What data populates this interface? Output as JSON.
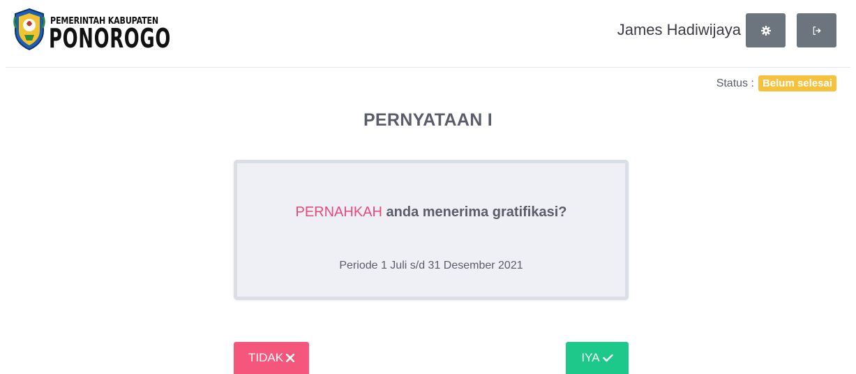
{
  "header": {
    "logo_line1": "PEMERINTAH KABUPATEN",
    "logo_line2": "PONOROGO",
    "username": "James Hadiwijaya",
    "settings_icon": "gear-icon",
    "logout_icon": "sign-out-icon"
  },
  "status": {
    "label": "Status :",
    "value": "Belum selesai",
    "color": "#f6c23e"
  },
  "main": {
    "title": "PERNYATAAN I",
    "question_highlight": "PERNAHKAH",
    "question_rest": " anda menerima gratifikasi?",
    "period": "Periode 1 Juli s/d 31 Desember 2021"
  },
  "actions": {
    "no_label": "TIDAK",
    "no_icon": "x-icon",
    "no_color": "#f4577b",
    "yes_label": "IYA",
    "yes_icon": "check-icon",
    "yes_color": "#1cc88a"
  }
}
